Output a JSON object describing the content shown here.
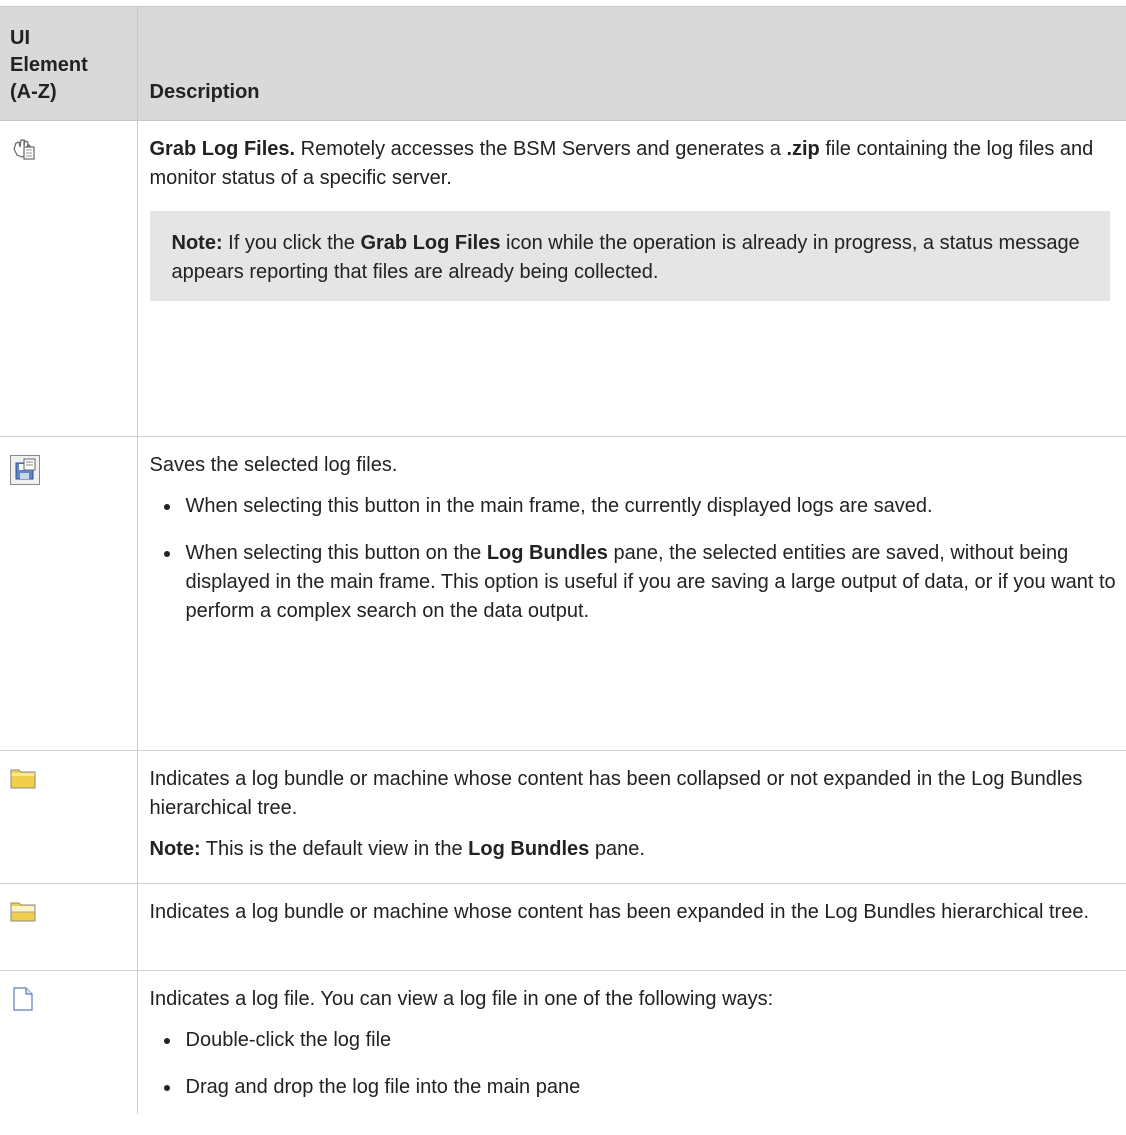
{
  "header": {
    "col1_line1": "UI",
    "col1_line2": "Element",
    "col1_line3": "(A-Z)",
    "col2": "Description"
  },
  "rows": [
    {
      "icon": "grab-log-files-icon",
      "title": "Grab Log Files.",
      "text_a": " Remotely accesses the BSM Servers and generates a ",
      "bold_zip": ".zip",
      "text_b": " file containing the log files and monitor status of a specific server.",
      "note_label": "Note:",
      "note_a": " If you click the ",
      "note_bold": "Grab Log Files",
      "note_b": " icon while the operation is already in progress, a status message appears reporting that files are already being collected."
    },
    {
      "icon": "save-icon",
      "text": "Saves the selected log files.",
      "bullet1": "When selecting this button in the main frame, the currently displayed logs are saved.",
      "bullet2_a": "When selecting this button on the ",
      "bullet2_bold": "Log Bundles",
      "bullet2_b": " pane, the selected entities are saved, without being displayed in the main frame. This option is useful if you are saving a large output of data, or if you want to perform a complex search on the data output."
    },
    {
      "icon": "folder-closed-icon",
      "text": "Indicates a log bundle or machine whose content has been collapsed or not expanded in the Log Bundles hierarchical tree.",
      "note_label": "Note:",
      "note_a": " This is the default view in the ",
      "note_bold": "Log Bundles",
      "note_b": " pane."
    },
    {
      "icon": "folder-open-icon",
      "text": "Indicates a log bundle or machine whose content has been expanded in the Log Bundles hierarchical tree."
    },
    {
      "icon": "log-file-icon",
      "text": "Indicates a log file. You can view a log file in one of the following ways:",
      "bullet1": "Double-click the log file",
      "bullet2": "Drag and drop the log file into the main pane"
    }
  ],
  "colors": {
    "header_bg": "#d9d9d9",
    "note_bg": "#e5e5e5",
    "folder_yellow": "#f2cf4a"
  }
}
